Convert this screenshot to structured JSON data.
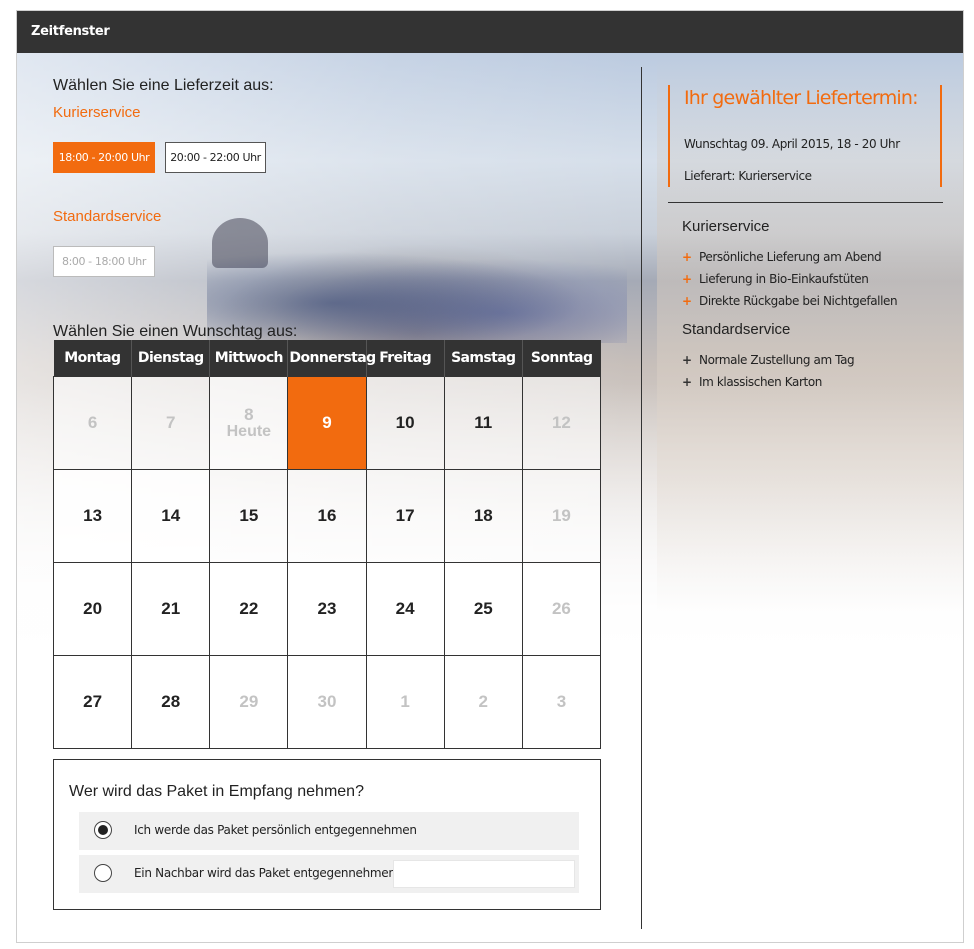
{
  "window": {
    "title": "Zeitfenster"
  },
  "time": {
    "prompt": "Wählen Sie eine Lieferzeit aus:",
    "courier_heading": "Kurierservice",
    "courier_slots": [
      {
        "label": "18:00 - 20:00 Uhr",
        "state": "selected"
      },
      {
        "label": "20:00 - 22:00 Uhr",
        "state": "available"
      }
    ],
    "standard_heading": "Standardservice",
    "standard_slots": [
      {
        "label": "8:00 - 18:00 Uhr",
        "state": "disabled"
      }
    ]
  },
  "calendar": {
    "prompt": "Wählen Sie einen Wunschtag aus:",
    "weekdays": [
      "Montag",
      "Dienstag",
      "Mittwoch",
      "Donnerstag",
      "Freitag",
      "Samstag",
      "Sonntag"
    ],
    "weeks": [
      [
        {
          "day": "6",
          "state": "muted"
        },
        {
          "day": "7",
          "state": "muted"
        },
        {
          "day": "8",
          "state": "today",
          "note": "Heute"
        },
        {
          "day": "9",
          "state": "selected"
        },
        {
          "day": "10",
          "state": "available"
        },
        {
          "day": "11",
          "state": "available"
        },
        {
          "day": "12",
          "state": "muted"
        }
      ],
      [
        {
          "day": "13",
          "state": "available"
        },
        {
          "day": "14",
          "state": "available"
        },
        {
          "day": "15",
          "state": "available"
        },
        {
          "day": "16",
          "state": "available"
        },
        {
          "day": "17",
          "state": "available"
        },
        {
          "day": "18",
          "state": "available"
        },
        {
          "day": "19",
          "state": "muted"
        }
      ],
      [
        {
          "day": "20",
          "state": "available"
        },
        {
          "day": "21",
          "state": "available"
        },
        {
          "day": "22",
          "state": "available"
        },
        {
          "day": "23",
          "state": "available"
        },
        {
          "day": "24",
          "state": "available"
        },
        {
          "day": "25",
          "state": "available"
        },
        {
          "day": "26",
          "state": "muted"
        }
      ],
      [
        {
          "day": "27",
          "state": "available"
        },
        {
          "day": "28",
          "state": "available"
        },
        {
          "day": "29",
          "state": "muted"
        },
        {
          "day": "30",
          "state": "muted"
        },
        {
          "day": "1",
          "state": "muted"
        },
        {
          "day": "2",
          "state": "muted"
        },
        {
          "day": "3",
          "state": "muted"
        }
      ]
    ]
  },
  "receiver": {
    "question": "Wer wird das Paket in Empfang nehmen?",
    "options": [
      {
        "label": "Ich werde das Paket persönlich entgegennehmen",
        "checked": true
      },
      {
        "label": "Ein Nachbar wird das Paket entgegennehmen:",
        "checked": false,
        "input_value": ""
      }
    ]
  },
  "summary": {
    "title": "Ihr gewählter Liefertermin:",
    "date_line": "Wunschtag 09. April 2015, 18 - 20 Uhr",
    "type_line": "Lieferart: Kurierservice"
  },
  "services": [
    {
      "heading": "Kurierservice",
      "features": [
        "Persönliche Lieferung am Abend",
        "Lieferung in Bio-Einkaufstüten",
        "Direkte Rückgabe bei Nichtgefallen"
      ]
    },
    {
      "heading": "Standardservice",
      "features": [
        "Normale Zustellung am Tag",
        "Im klassischen Karton"
      ]
    }
  ],
  "colors": {
    "accent": "#f26b0f",
    "dark": "#333333",
    "muted_text": "#c3c3c3"
  },
  "icons": {
    "bullet": "plus-icon",
    "radio": "radio-icon"
  }
}
